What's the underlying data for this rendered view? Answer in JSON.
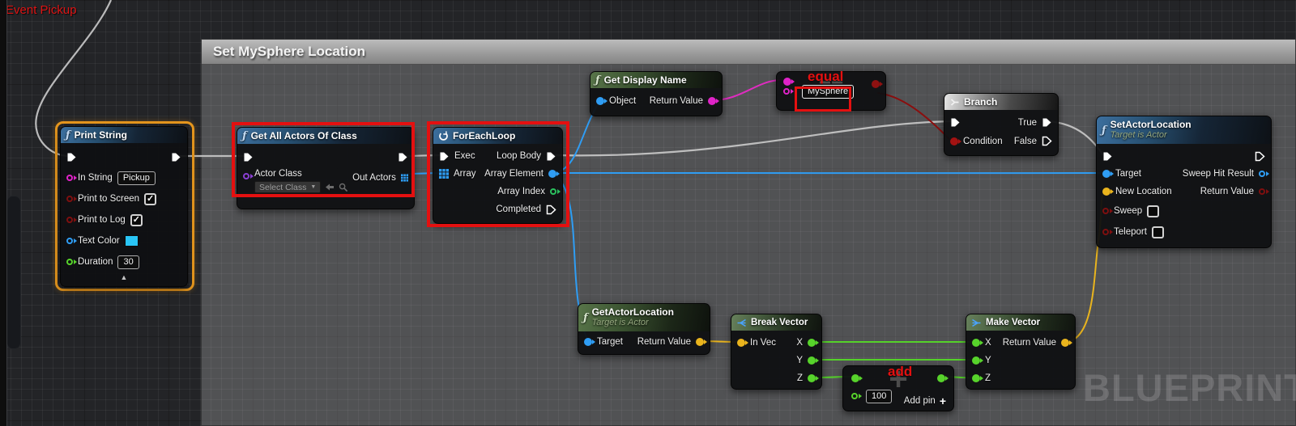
{
  "canvas": {
    "event_label": "Event Pickup",
    "comment_title": "Set MySphere Location",
    "watermark": "BLUEPRINT"
  },
  "glyphs": {
    "function": "ƒ",
    "collapse": "▲",
    "dropdown_caret": "▼",
    "check": "✓",
    "equals": "==",
    "plus_large": "+",
    "add_pin_plus": "+"
  },
  "nodes": {
    "print_string": {
      "title": "Print String",
      "in_string": "In String",
      "in_string_value": "Pickup",
      "print_to_screen": "Print to Screen",
      "print_to_log": "Print to Log",
      "text_color": "Text Color",
      "duration": "Duration",
      "duration_value": "30"
    },
    "get_all_actors": {
      "title": "Get All Actors Of Class",
      "actor_class": "Actor Class",
      "select_class": "Select Class",
      "out_actors": "Out Actors"
    },
    "foreach_loop": {
      "title": "ForEachLoop",
      "exec": "Exec",
      "array": "Array",
      "loop_body": "Loop Body",
      "array_element": "Array Element",
      "array_index": "Array Index",
      "completed": "Completed"
    },
    "get_display_name": {
      "title": "Get Display Name",
      "object": "Object",
      "return_value": "Return Value"
    },
    "equal": {
      "annotation": "equal",
      "value": "MySphere"
    },
    "branch": {
      "title": "Branch",
      "condition": "Condition",
      "true_label": "True",
      "false_label": "False"
    },
    "set_actor_location": {
      "title": "SetActorLocation",
      "subtitle": "Target is Actor",
      "target": "Target",
      "new_location": "New Location",
      "sweep": "Sweep",
      "teleport": "Teleport",
      "sweep_hit_result": "Sweep Hit Result",
      "return_value": "Return Value"
    },
    "get_actor_location": {
      "title": "GetActorLocation",
      "subtitle": "Target is Actor",
      "target": "Target",
      "return_value": "Return Value"
    },
    "break_vector": {
      "title": "Break Vector",
      "in_vec": "In Vec",
      "x": "X",
      "y": "Y",
      "z": "Z"
    },
    "add": {
      "annotation": "add",
      "value": "100",
      "add_pin": "Add pin"
    },
    "make_vector": {
      "title": "Make Vector",
      "x": "X",
      "y": "Y",
      "z": "Z",
      "return_value": "Return Value"
    }
  },
  "colors": {
    "exec_wire": "#c8c8c8",
    "wire_blue": "#2f9df4",
    "wire_magenta": "#df2cc0",
    "wire_red": "#8b0e0e",
    "wire_yellow": "#e9b41e",
    "wire_green": "#55d22a",
    "annotation_red": "#e41010",
    "selection_orange": "#e8981e",
    "string_pin": "#e023c8",
    "bool_pin": "#7e0f0f",
    "object_pin": "#2f9df4",
    "float_pin": "#57d32b",
    "int_pin": "#2bc05e",
    "vector_pin": "#eab41d",
    "class_pin": "#8a3fd3",
    "array_pin": "#2e9cf2",
    "text_color_swatch": "#29c5f6"
  }
}
